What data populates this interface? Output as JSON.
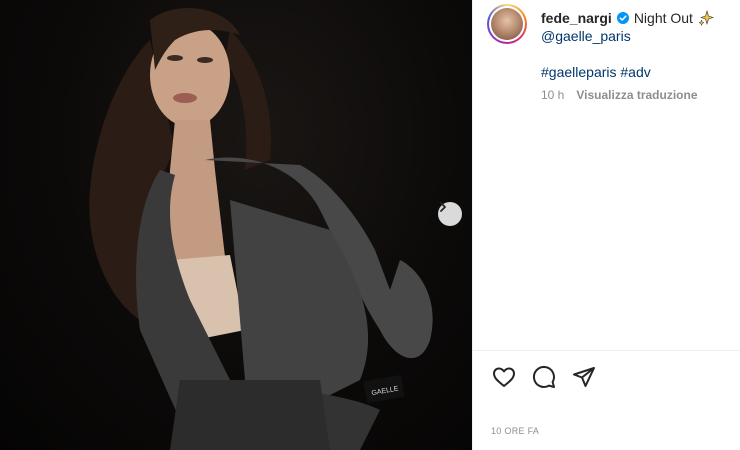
{
  "post": {
    "username": "fede_nargi",
    "title": "Night Out",
    "mention": "@gaelle_paris",
    "hashtags": [
      "#gaelleparis",
      "#adv"
    ],
    "relative_time": "10 h",
    "translate_label": "Visualizza traduzione",
    "footer_time": "10 ORE FA",
    "jacket_label": "GAELLE"
  },
  "icons": {
    "verified": "verified-badge-icon",
    "sparkles": "sparkles-icon",
    "next": "chevron-right-icon",
    "like": "heart-icon",
    "comment": "comment-bubble-icon",
    "share": "paper-plane-icon"
  },
  "colors": {
    "link": "#00376b",
    "muted": "#8e8e8e",
    "verified": "#0095f6"
  }
}
